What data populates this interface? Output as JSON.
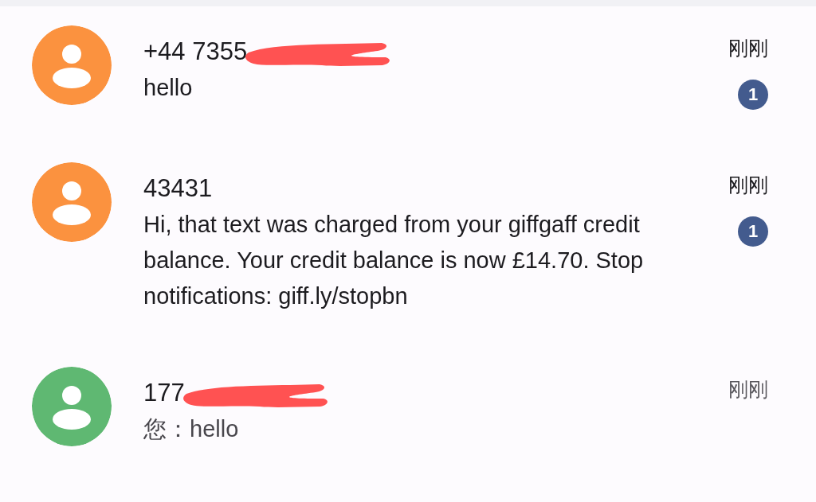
{
  "conversations": [
    {
      "name": "+44 7355",
      "redacted": true,
      "message": "hello",
      "time": "刚刚",
      "unread": true,
      "badge": "1",
      "color": "#fb923f"
    },
    {
      "name": "43431",
      "redacted": false,
      "message": "Hi, that text was charged from your giffgaff credit balance. Your credit balance is now £14.70. Stop notifications: giff.ly/stopbn",
      "time": "刚刚",
      "unread": true,
      "badge": "1",
      "color": "#fb923f"
    },
    {
      "name": "177",
      "redacted": true,
      "message": "您：hello",
      "time": "刚刚",
      "unread": false,
      "color": "#5fb872"
    }
  ]
}
